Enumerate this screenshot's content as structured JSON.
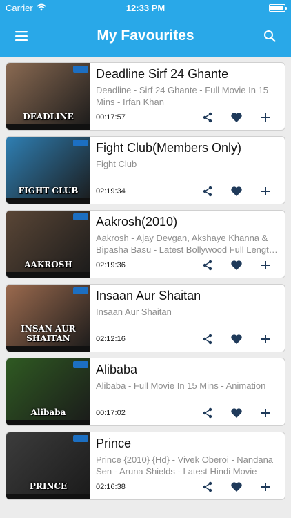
{
  "status_bar": {
    "carrier": "Carrier",
    "time": "12:33 PM",
    "battery_level": 0.95
  },
  "header": {
    "title": "My Favourites",
    "menu_icon": "hamburger-menu-icon",
    "search_icon": "search-icon"
  },
  "colors": {
    "header_bg": "#29a8e8",
    "action_icon": "#1f3a5a",
    "card_bg": "#ffffff",
    "page_bg": "#ececec"
  },
  "items": [
    {
      "title": "Deadline Sirf 24 Ghante",
      "description": "Deadline - Sirf 24 Ghante - Full Movie In 15 Mins - Irfan Khan",
      "duration": "00:17:57",
      "thumbnail_text": "DEADLINE",
      "thumbnail_color": "#8a6a52"
    },
    {
      "title": "Fight Club(Members Only)",
      "description": "Fight Club",
      "duration": "02:19:34",
      "thumbnail_text": "FIGHT CLUB",
      "thumbnail_color": "#2f7fb3"
    },
    {
      "title": "Aakrosh(2010)",
      "description": "Aakrosh - Ajay Devgan, Akshaye Khanna & Bipasha Basu - Latest Bollywood Full Length Movie",
      "duration": "02:19:36",
      "thumbnail_text": "AAKROSH",
      "thumbnail_color": "#5a4636"
    },
    {
      "title": "Insaan Aur Shaitan",
      "description": "Insaan Aur Shaitan",
      "duration": "02:12:16",
      "thumbnail_text": "INSAN AUR SHAITAN",
      "thumbnail_color": "#9b6a4e"
    },
    {
      "title": "Alibaba",
      "description": "Alibaba - Full Movie In 15 Mins - Animation",
      "duration": "00:17:02",
      "thumbnail_text": "Alibaba",
      "thumbnail_color": "#2f5a22"
    },
    {
      "title": "Prince",
      "description": "Prince {2010} {Hd} - Vivek Oberoi - Nandana Sen - Aruna Shields - Latest Hindi Movie",
      "duration": "02:16:38",
      "thumbnail_text": "PRINCE",
      "thumbnail_color": "#3c3c3c"
    }
  ]
}
